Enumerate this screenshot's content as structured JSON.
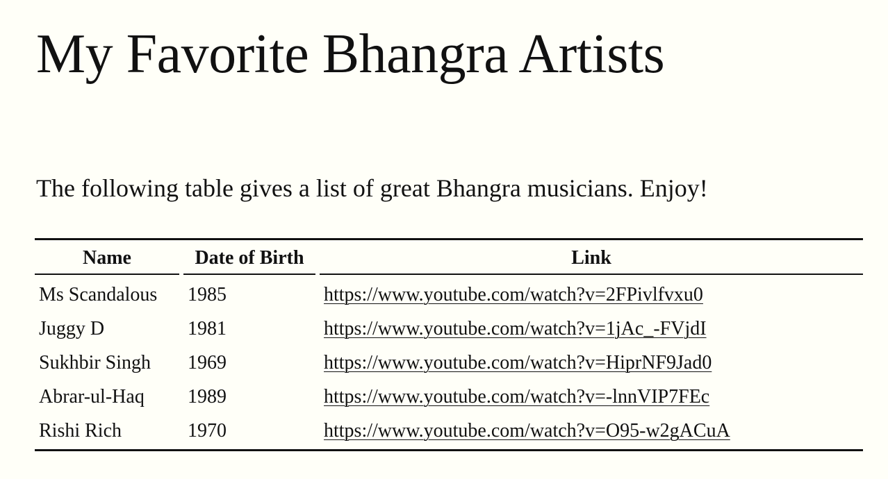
{
  "page": {
    "title": "My Favorite Bhangra Artists",
    "intro": "The following table gives a list of great Bhangra musicians. Enjoy!"
  },
  "table": {
    "headers": {
      "name": "Name",
      "dob": "Date of Birth",
      "link": "Link"
    },
    "rows": [
      {
        "name": "Ms Scandalous",
        "dob": "1985",
        "link": "https://www.youtube.com/watch?v=2FPivlfvxu0"
      },
      {
        "name": "Juggy D",
        "dob": "1981",
        "link": "https://www.youtube.com/watch?v=1jAc_-FVjdI"
      },
      {
        "name": "Sukhbir Singh",
        "dob": "1969",
        "link": "https://www.youtube.com/watch?v=HiprNF9Jad0"
      },
      {
        "name": "Abrar-ul-Haq",
        "dob": "1989",
        "link": "https://www.youtube.com/watch?v=-lnnVIP7FEc"
      },
      {
        "name": "Rishi Rich",
        "dob": "1970",
        "link": "https://www.youtube.com/watch?v=O95-w2gACuA"
      }
    ]
  }
}
